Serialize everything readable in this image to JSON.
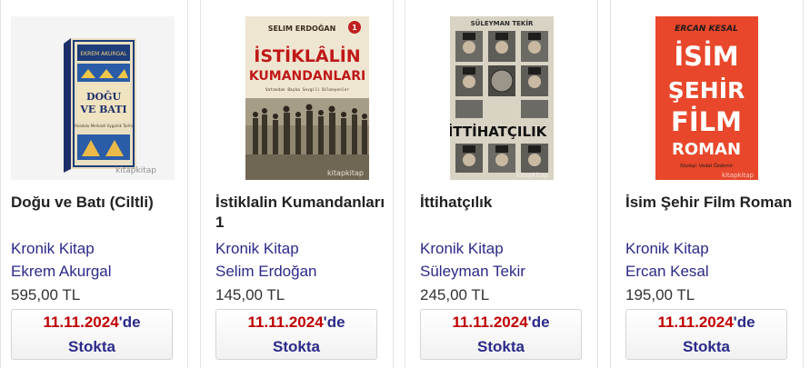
{
  "products": [
    {
      "title": "Doğu ve Batı (Ciltli)",
      "publisher": "Kronik Kitap",
      "author": "Ekrem Akurgal",
      "price": "595,00 TL",
      "stock_date": "11.11.2024",
      "stock_suffix": "'de",
      "stock_status": "Stokta",
      "cover": {
        "author_text": "EKREM AKURGAL",
        "title_line1": "DOĞU",
        "title_line2": "VE BATI",
        "subtitle": "Anadolu Merkezli Uygarlık Tarihi",
        "watermark": "kitapkitap"
      }
    },
    {
      "title": "İstiklalin Kumandanları 1",
      "publisher": "Kronik Kitap",
      "author": "Selim Erdoğan",
      "price": "145,00 TL",
      "stock_date": "11.11.2024",
      "stock_suffix": "'de",
      "stock_status": "Stokta",
      "cover": {
        "author_text": "SELIM ERDOĞAN",
        "badge": "1",
        "title_line1": "İSTİKLÂLİN",
        "title_line2": "KUMANDANLARI",
        "subtitle": "Vatandan Başka Sevgili Bilmeyenler",
        "watermark": "kitapkitap"
      }
    },
    {
      "title": "İttihatçılık",
      "publisher": "Kronik Kitap",
      "author": "Süleyman Tekir",
      "price": "245,00 TL",
      "stock_date": "11.11.2024",
      "stock_suffix": "'de",
      "stock_status": "Stokta",
      "cover": {
        "author_text": "SÜLEYMAN TEKİR",
        "title_line1": "İTTİHATÇILIK",
        "watermark": "kitapkitap"
      }
    },
    {
      "title": "İsim Şehir Film Roman",
      "publisher": "Kronik Kitap",
      "author": "Ercan Kesal",
      "price": "195,00 TL",
      "stock_date": "11.11.2024",
      "stock_suffix": "'de",
      "stock_status": "Stokta",
      "cover": {
        "author_text": "ERCAN KESAL",
        "title_line1": "İSİM",
        "title_line2": "ŞEHİR",
        "title_line3": "FİLM",
        "title_line4": "ROMAN",
        "subtitle": "Söyleşi: Vedat Özdemir",
        "watermark": "kitapkitap"
      }
    }
  ],
  "colors": {
    "link": "#2b2a8a",
    "stock_date": "#c00000",
    "title": "#222222"
  }
}
